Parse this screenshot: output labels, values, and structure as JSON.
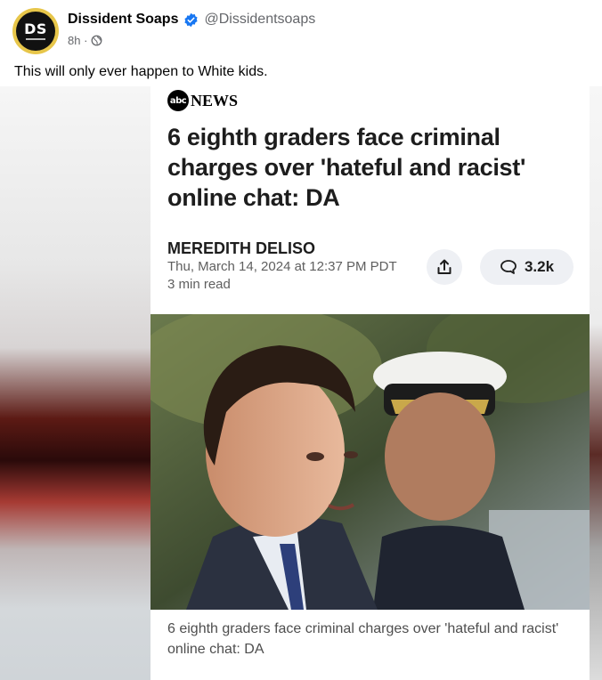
{
  "post": {
    "author_name": "Dissident Soaps",
    "handle": "@Dissidentsoaps",
    "time": "8h ·",
    "text": "This will only ever happen to White kids.",
    "avatar_initials": "DS"
  },
  "article": {
    "source_logo": "abc",
    "source_name": "NEWS",
    "headline": "6 eighth graders face criminal charges over 'hateful and racist' online chat: DA",
    "author": "MEREDITH DELISO",
    "date": "Thu, March 14, 2024 at 12:37 PM PDT",
    "read_time": "3 min read",
    "comment_count": "3.2k",
    "caption": "6 eighth graders face criminal charges over 'hateful and racist' online chat: DA"
  },
  "colors": {
    "verified": "#1877f2",
    "avatar_ring": "#e7c64a",
    "secondary_text": "#65676b"
  },
  "icons": [
    "verified-badge-icon",
    "globe-icon",
    "share-icon",
    "comment-icon"
  ]
}
